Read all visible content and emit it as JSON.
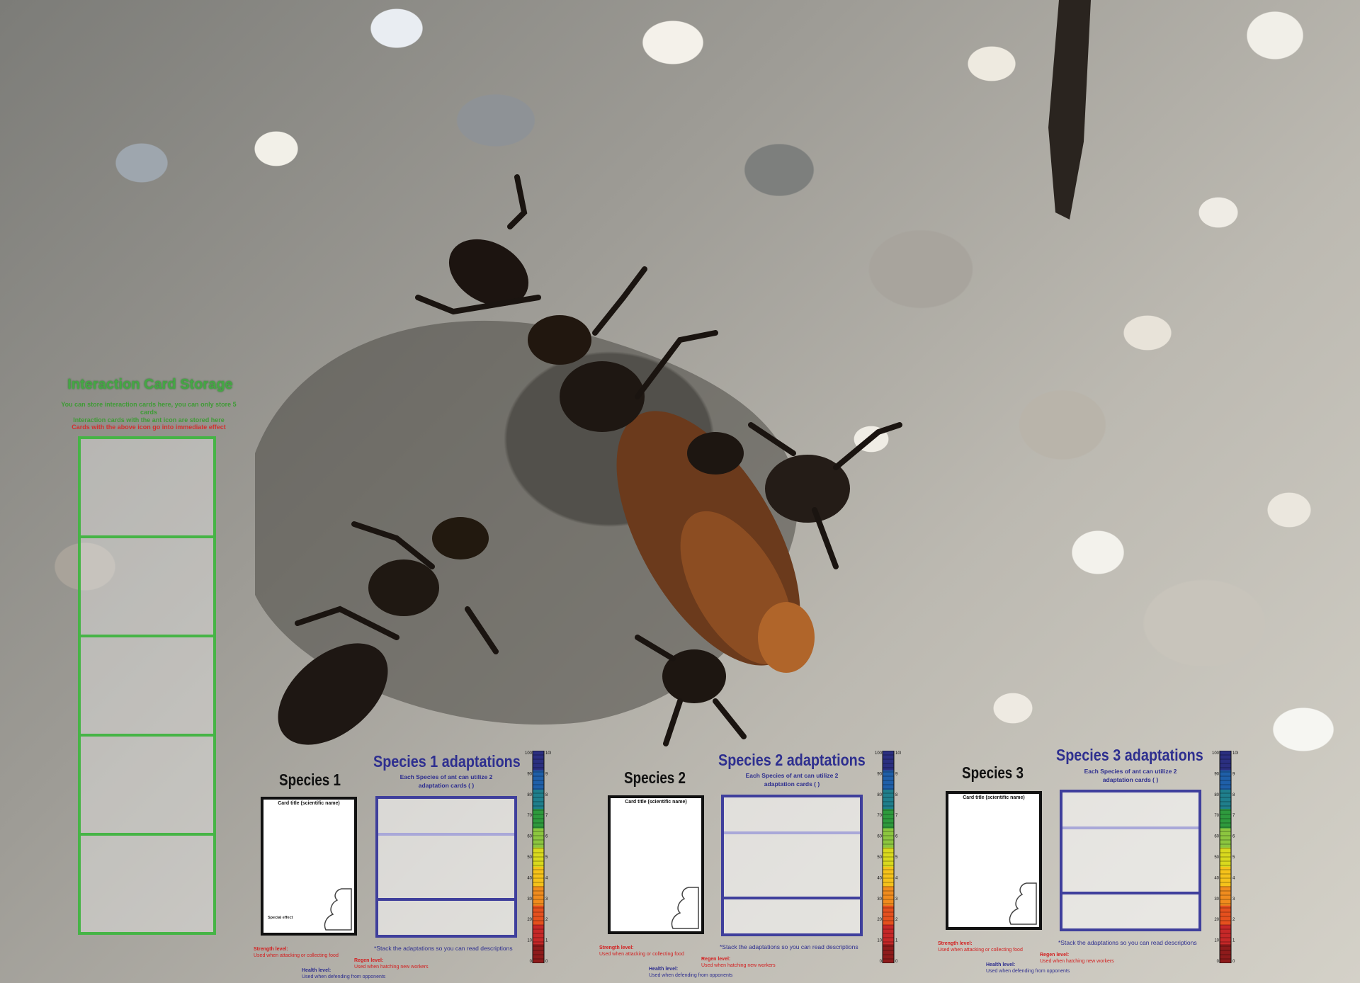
{
  "storage": {
    "title": "Interaction Card Storage",
    "desc_line1": "You can store interaction cards here, you can only store 5 cards",
    "desc_line2": "Interaction cards with the ant icon are stored here",
    "note": "Cards with the above icon go into immediate effect",
    "slots": 5
  },
  "species": [
    {
      "title": "Species 1",
      "adapt_title": "Species 1 adaptations",
      "adapt_sub_line1": "Each Species of ant can utilize 2",
      "adapt_sub_line2": "adaptation cards ( )",
      "card_title": "Card title (scientific name)",
      "card_special": "Special effect",
      "stack_note": "*Stack the adaptations so you can read descriptions",
      "strength_label": "Strength level:",
      "strength_desc": "Used when attacking or collecting food",
      "health_label": "Health level:",
      "health_desc": "Used when defending from opponents",
      "regen_label": "Regen level:",
      "regen_desc": "Used when hatching new workers"
    },
    {
      "title": "Species 2",
      "adapt_title": "Species 2 adaptations",
      "adapt_sub_line1": "Each Species of ant can utilize 2",
      "adapt_sub_line2": "adaptation cards ( )",
      "card_title": "Card title (scientific name)",
      "card_special": "",
      "stack_note": "*Stack the adaptations so you can read descriptions",
      "strength_label": "Strength level:",
      "strength_desc": "Used when attacking or collecting food",
      "health_label": "Health level:",
      "health_desc": "Used when defending from opponents",
      "regen_label": "Regen level:",
      "regen_desc": "Used when hatching new workers"
    },
    {
      "title": "Species 3",
      "adapt_title": "Species 3 adaptations",
      "adapt_sub_line1": "Each Species of ant can utilize 2",
      "adapt_sub_line2": "adaptation cards ( )",
      "card_title": "Card title (scientific name)",
      "card_special": "",
      "stack_note": "*Stack the adaptations so you can read descriptions",
      "strength_label": "Strength level:",
      "strength_desc": "Used when attacking or collecting food",
      "health_label": "Health level:",
      "health_desc": "Used when defending from opponents",
      "regen_label": "Regen level:",
      "regen_desc": "Used when hatching new workers"
    }
  ],
  "meter": {
    "min": 0,
    "max": 100,
    "colors": [
      "#8e1b1b",
      "#c62828",
      "#e5501e",
      "#f08c1e",
      "#f5c21b",
      "#d9d91e",
      "#8cc63f",
      "#2e9a3d",
      "#1f7f8c",
      "#1f5fa8",
      "#2b2f80"
    ],
    "left_labels": [
      "100",
      "90",
      "80",
      "70",
      "60",
      "50",
      "40",
      "30",
      "20",
      "10",
      "0"
    ],
    "right_labels": [
      "100",
      "9",
      "8",
      "7",
      "6",
      "5",
      "4",
      "3",
      "2",
      "1",
      "0"
    ]
  },
  "colors": {
    "storage_green": "#46b446",
    "adapt_blue": "#3f3f9c",
    "label_red": "#d32020"
  }
}
